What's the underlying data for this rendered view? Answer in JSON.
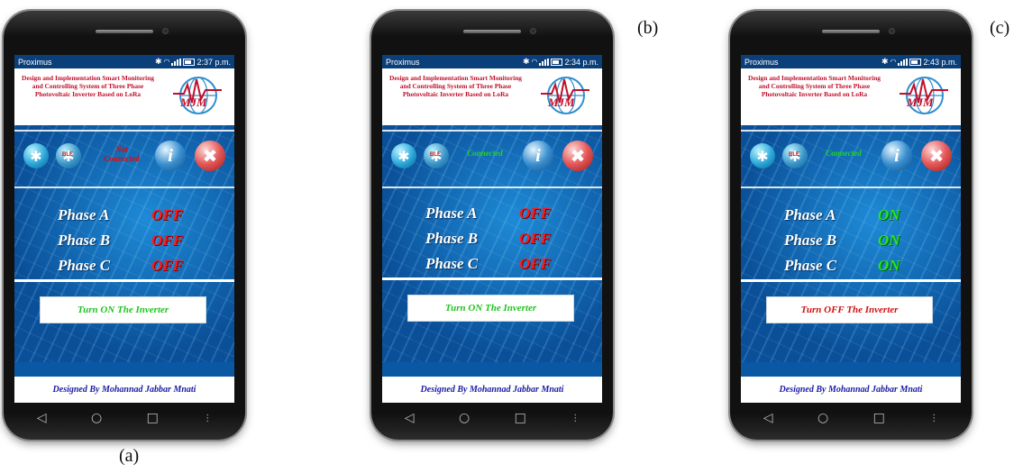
{
  "panels": [
    {
      "label": "(a)",
      "status": {
        "carrier": "Proximus",
        "time": "2:37 p.m."
      },
      "header": {
        "title": "Design and Implementation Smart Monitoring and Controlling System of Three Phase Photovoltaic Inverter Based on LoRa",
        "logo": "MJM"
      },
      "connection": {
        "text": "Not Connected",
        "color": "#d01010"
      },
      "phases": [
        {
          "name": "Phase A",
          "state": "OFF"
        },
        {
          "name": "Phase B",
          "state": "OFF"
        },
        {
          "name": "Phase C",
          "state": "OFF"
        }
      ],
      "button": "Turn ON The Inverter",
      "footer": "Designed By Mohannad Jabbar Mnati"
    },
    {
      "label": "(b)",
      "status": {
        "carrier": "Proximus",
        "time": "2:34 p.m."
      },
      "header": {
        "title": "Design and Implementation Smart Monitoring and Controlling System of Three Phase Photovoltaic Inverter Based on LoRa",
        "logo": "MJM"
      },
      "connection": {
        "text": "Connected",
        "color": "#22d622"
      },
      "phases": [
        {
          "name": "Phase A",
          "state": "OFF"
        },
        {
          "name": "Phase B",
          "state": "OFF"
        },
        {
          "name": "Phase C",
          "state": "OFF"
        }
      ],
      "button": "Turn ON The Inverter",
      "footer": "Designed By Mohannad Jabbar Mnati"
    },
    {
      "label": "(c)",
      "status": {
        "carrier": "Proximus",
        "time": "2:43 p.m."
      },
      "header": {
        "title": "Design and Implementation Smart Monitoring and Controlling System of Three Phase Photovoltaic Inverter Based on LoRa",
        "logo": "MJM"
      },
      "connection": {
        "text": "Connected",
        "color": "#22d622"
      },
      "phases": [
        {
          "name": "Phase A",
          "state": "ON"
        },
        {
          "name": "Phase B",
          "state": "ON"
        },
        {
          "name": "Phase C",
          "state": "ON"
        }
      ],
      "button": "Turn OFF The Inverter",
      "footer": "Designed By Mohannad Jabbar Mnati"
    }
  ],
  "icons": {
    "bluetooth": "bluetooth-icon",
    "ble": "bluetooth-le-icon",
    "info": "info-icon",
    "close": "close-icon",
    "back": "back-nav-icon",
    "home": "home-nav-icon",
    "recents": "recents-nav-icon",
    "menu": "menu-nav-icon"
  }
}
